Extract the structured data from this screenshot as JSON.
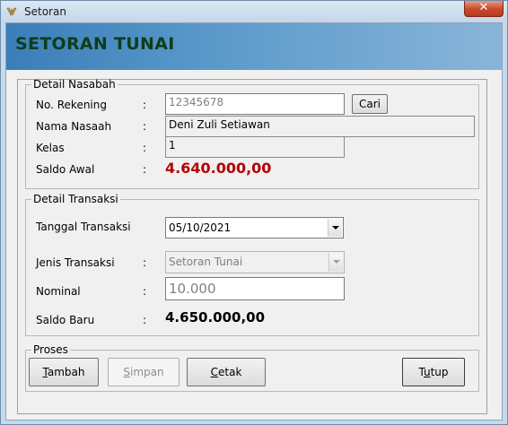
{
  "window": {
    "title": "Setoran",
    "close_glyph": "✕"
  },
  "header": {
    "title": "SETORAN TUNAI"
  },
  "detail_nasabah": {
    "legend": "Detail Nasabah",
    "no_rekening": {
      "label": "No. Rekening",
      "value": "12345678"
    },
    "cari_button": "Cari",
    "nama": {
      "label": "Nama Nasaah",
      "value": "Deni Zuli Setiawan"
    },
    "kelas": {
      "label": "Kelas",
      "value": "1"
    },
    "saldo_awal": {
      "label": "Saldo Awal",
      "value": "4.640.000,00"
    }
  },
  "detail_transaksi": {
    "legend": "Detail Transaksi",
    "tanggal": {
      "label": "Tanggal Transaksi",
      "value": "05/10/2021"
    },
    "jenis": {
      "label": "Jenis Transaksi",
      "value": "Setoran Tunai"
    },
    "nominal": {
      "label": "Nominal",
      "value": "10.000"
    },
    "saldo_baru": {
      "label": "Saldo Baru",
      "value": "4.650.000,00"
    }
  },
  "proses": {
    "legend": "Proses",
    "tambah": {
      "pre": "",
      "key": "T",
      "post": "ambah"
    },
    "simpan": {
      "pre": "",
      "key": "S",
      "post": "impan"
    },
    "cetak": {
      "pre": "",
      "key": "C",
      "post": "etak"
    },
    "tutup": {
      "pre": "T",
      "key": "u",
      "post": "tup"
    }
  },
  "colon": ":",
  "colors": {
    "saldo_awal": "#b40000",
    "header_title": "#0e3d1c",
    "header_band": "#4a8cc2"
  }
}
